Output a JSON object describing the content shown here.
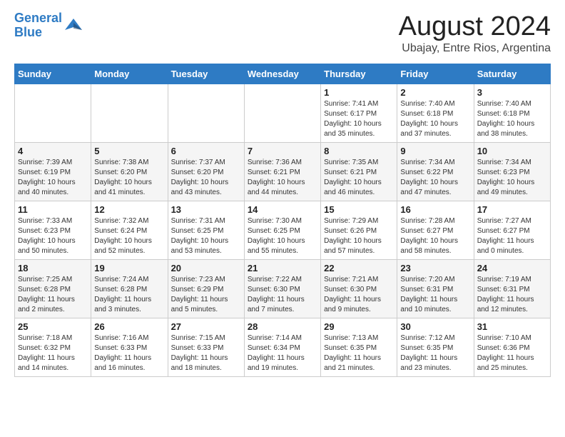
{
  "header": {
    "logo_line1": "General",
    "logo_line2": "Blue",
    "month_title": "August 2024",
    "subtitle": "Ubajay, Entre Rios, Argentina"
  },
  "weekdays": [
    "Sunday",
    "Monday",
    "Tuesday",
    "Wednesday",
    "Thursday",
    "Friday",
    "Saturday"
  ],
  "weeks": [
    [
      {
        "day": "",
        "content": ""
      },
      {
        "day": "",
        "content": ""
      },
      {
        "day": "",
        "content": ""
      },
      {
        "day": "",
        "content": ""
      },
      {
        "day": "1",
        "content": "Sunrise: 7:41 AM\nSunset: 6:17 PM\nDaylight: 10 hours\nand 35 minutes."
      },
      {
        "day": "2",
        "content": "Sunrise: 7:40 AM\nSunset: 6:18 PM\nDaylight: 10 hours\nand 37 minutes."
      },
      {
        "day": "3",
        "content": "Sunrise: 7:40 AM\nSunset: 6:18 PM\nDaylight: 10 hours\nand 38 minutes."
      }
    ],
    [
      {
        "day": "4",
        "content": "Sunrise: 7:39 AM\nSunset: 6:19 PM\nDaylight: 10 hours\nand 40 minutes."
      },
      {
        "day": "5",
        "content": "Sunrise: 7:38 AM\nSunset: 6:20 PM\nDaylight: 10 hours\nand 41 minutes."
      },
      {
        "day": "6",
        "content": "Sunrise: 7:37 AM\nSunset: 6:20 PM\nDaylight: 10 hours\nand 43 minutes."
      },
      {
        "day": "7",
        "content": "Sunrise: 7:36 AM\nSunset: 6:21 PM\nDaylight: 10 hours\nand 44 minutes."
      },
      {
        "day": "8",
        "content": "Sunrise: 7:35 AM\nSunset: 6:21 PM\nDaylight: 10 hours\nand 46 minutes."
      },
      {
        "day": "9",
        "content": "Sunrise: 7:34 AM\nSunset: 6:22 PM\nDaylight: 10 hours\nand 47 minutes."
      },
      {
        "day": "10",
        "content": "Sunrise: 7:34 AM\nSunset: 6:23 PM\nDaylight: 10 hours\nand 49 minutes."
      }
    ],
    [
      {
        "day": "11",
        "content": "Sunrise: 7:33 AM\nSunset: 6:23 PM\nDaylight: 10 hours\nand 50 minutes."
      },
      {
        "day": "12",
        "content": "Sunrise: 7:32 AM\nSunset: 6:24 PM\nDaylight: 10 hours\nand 52 minutes."
      },
      {
        "day": "13",
        "content": "Sunrise: 7:31 AM\nSunset: 6:25 PM\nDaylight: 10 hours\nand 53 minutes."
      },
      {
        "day": "14",
        "content": "Sunrise: 7:30 AM\nSunset: 6:25 PM\nDaylight: 10 hours\nand 55 minutes."
      },
      {
        "day": "15",
        "content": "Sunrise: 7:29 AM\nSunset: 6:26 PM\nDaylight: 10 hours\nand 57 minutes."
      },
      {
        "day": "16",
        "content": "Sunrise: 7:28 AM\nSunset: 6:27 PM\nDaylight: 10 hours\nand 58 minutes."
      },
      {
        "day": "17",
        "content": "Sunrise: 7:27 AM\nSunset: 6:27 PM\nDaylight: 11 hours\nand 0 minutes."
      }
    ],
    [
      {
        "day": "18",
        "content": "Sunrise: 7:25 AM\nSunset: 6:28 PM\nDaylight: 11 hours\nand 2 minutes."
      },
      {
        "day": "19",
        "content": "Sunrise: 7:24 AM\nSunset: 6:28 PM\nDaylight: 11 hours\nand 3 minutes."
      },
      {
        "day": "20",
        "content": "Sunrise: 7:23 AM\nSunset: 6:29 PM\nDaylight: 11 hours\nand 5 minutes."
      },
      {
        "day": "21",
        "content": "Sunrise: 7:22 AM\nSunset: 6:30 PM\nDaylight: 11 hours\nand 7 minutes."
      },
      {
        "day": "22",
        "content": "Sunrise: 7:21 AM\nSunset: 6:30 PM\nDaylight: 11 hours\nand 9 minutes."
      },
      {
        "day": "23",
        "content": "Sunrise: 7:20 AM\nSunset: 6:31 PM\nDaylight: 11 hours\nand 10 minutes."
      },
      {
        "day": "24",
        "content": "Sunrise: 7:19 AM\nSunset: 6:31 PM\nDaylight: 11 hours\nand 12 minutes."
      }
    ],
    [
      {
        "day": "25",
        "content": "Sunrise: 7:18 AM\nSunset: 6:32 PM\nDaylight: 11 hours\nand 14 minutes."
      },
      {
        "day": "26",
        "content": "Sunrise: 7:16 AM\nSunset: 6:33 PM\nDaylight: 11 hours\nand 16 minutes."
      },
      {
        "day": "27",
        "content": "Sunrise: 7:15 AM\nSunset: 6:33 PM\nDaylight: 11 hours\nand 18 minutes."
      },
      {
        "day": "28",
        "content": "Sunrise: 7:14 AM\nSunset: 6:34 PM\nDaylight: 11 hours\nand 19 minutes."
      },
      {
        "day": "29",
        "content": "Sunrise: 7:13 AM\nSunset: 6:35 PM\nDaylight: 11 hours\nand 21 minutes."
      },
      {
        "day": "30",
        "content": "Sunrise: 7:12 AM\nSunset: 6:35 PM\nDaylight: 11 hours\nand 23 minutes."
      },
      {
        "day": "31",
        "content": "Sunrise: 7:10 AM\nSunset: 6:36 PM\nDaylight: 11 hours\nand 25 minutes."
      }
    ]
  ]
}
